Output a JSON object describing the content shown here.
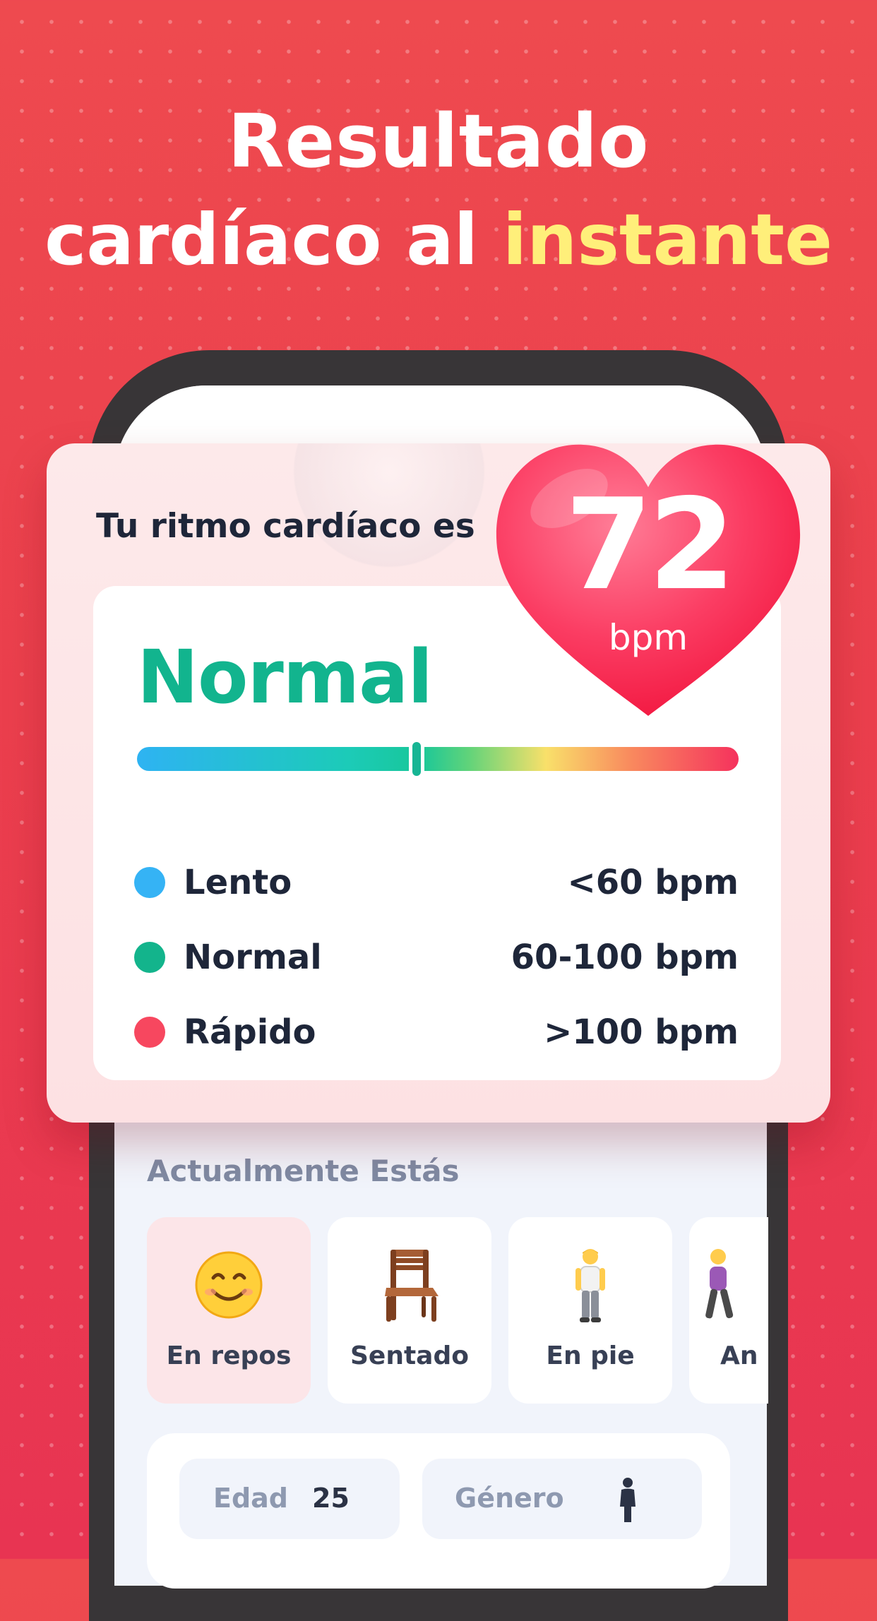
{
  "headline": {
    "line1": "Resultado",
    "line2_prefix": "cardíaco al ",
    "line2_accent": "instante"
  },
  "result_card": {
    "title": "Tu ritmo cardíaco es",
    "bpm_value": "72",
    "bpm_unit": "bpm",
    "status": "Normal",
    "gauge_position_percent": 46.5,
    "legend": [
      {
        "label": "Lento",
        "range": "<60 bpm",
        "color": "#35b3f5"
      },
      {
        "label": "Normal",
        "range": "60-100 bpm",
        "color": "#13b48c"
      },
      {
        "label": "Rápido",
        "range": ">100 bpm",
        "color": "#f7475f"
      }
    ]
  },
  "current_state": {
    "title": "Actualmente Estás",
    "options": [
      {
        "label": "En repos",
        "icon": "smiling-face-icon",
        "selected": true
      },
      {
        "label": "Sentado",
        "icon": "chair-icon",
        "selected": false
      },
      {
        "label": "En pie",
        "icon": "standing-person-icon",
        "selected": false
      },
      {
        "label": "An",
        "icon": "walking-person-icon",
        "selected": false
      }
    ]
  },
  "profile": {
    "age_label": "Edad",
    "age_value": "25",
    "gender_label": "Género",
    "gender_icon": "person-icon"
  },
  "colors": {
    "background": "#eb3f4d",
    "accent_yellow": "#ffef7a",
    "normal_green": "#13b48c",
    "heart_red": "#fb3560"
  }
}
